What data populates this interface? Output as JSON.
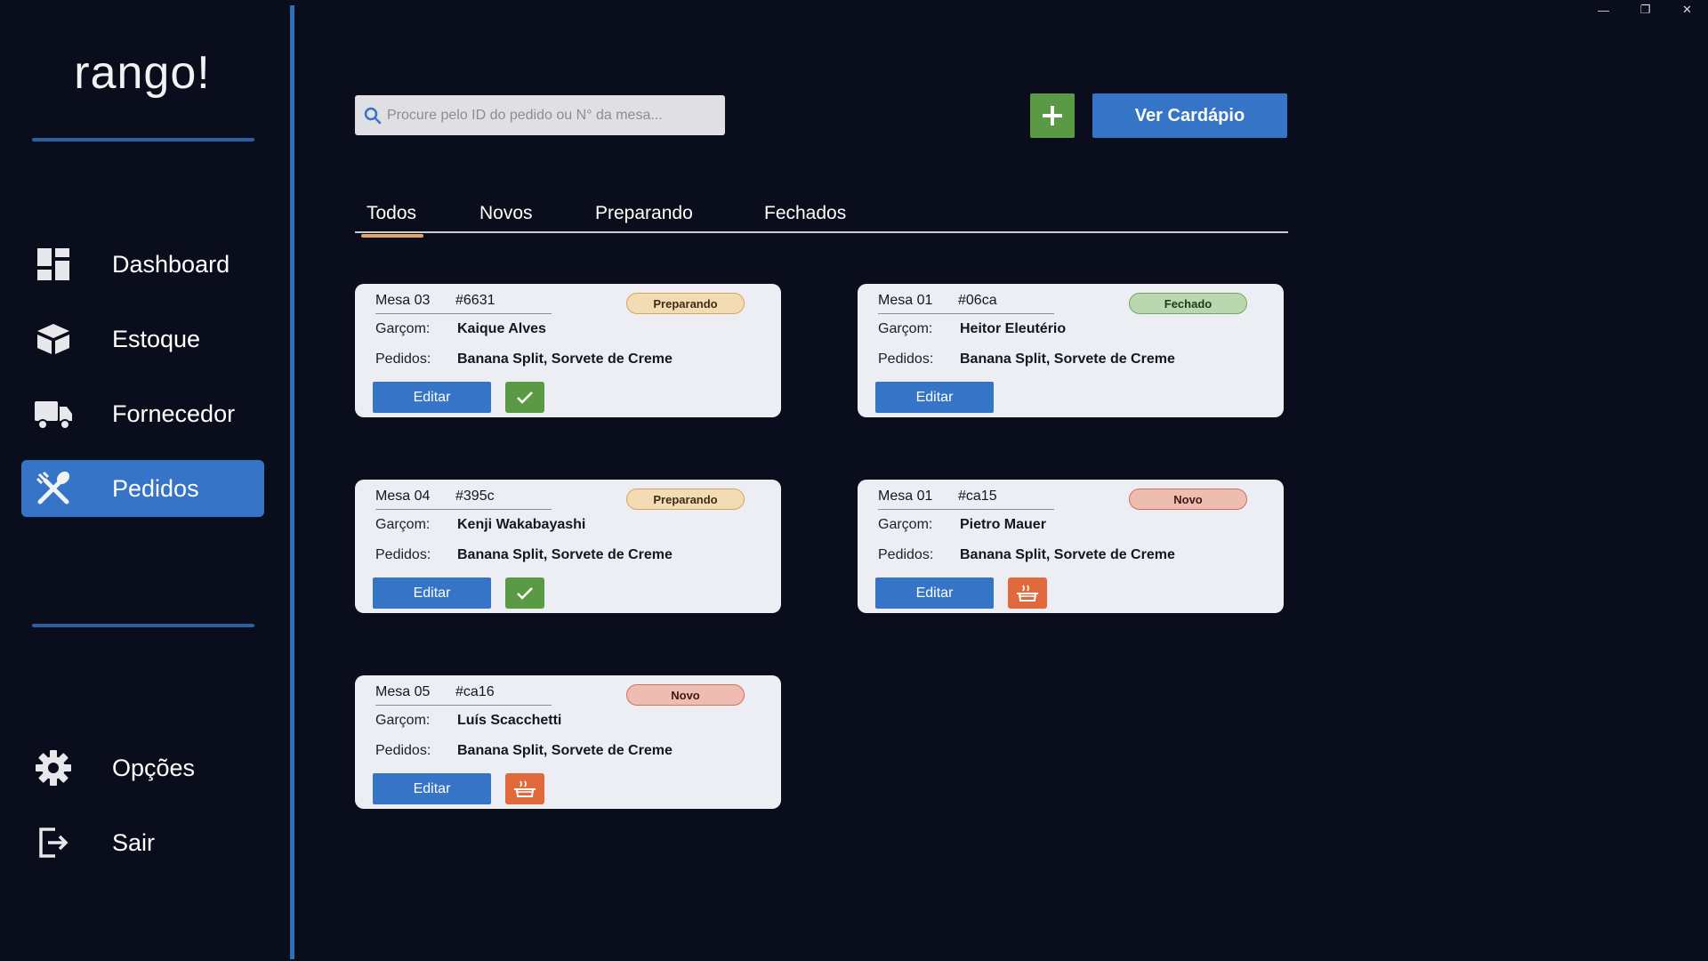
{
  "window": {
    "minimize": "—",
    "restore": "❐",
    "close": "✕"
  },
  "sidebar": {
    "logo": "rango!",
    "items": [
      {
        "label": "Dashboard",
        "icon": "dashboard-icon"
      },
      {
        "label": "Estoque",
        "icon": "box-icon"
      },
      {
        "label": "Fornecedor",
        "icon": "truck-icon"
      },
      {
        "label": "Pedidos",
        "icon": "cutlery-icon",
        "active": true
      }
    ],
    "bottom_items": [
      {
        "label": "Opções",
        "icon": "gear-icon"
      },
      {
        "label": "Sair",
        "icon": "logout-icon"
      }
    ]
  },
  "search": {
    "placeholder": "Procure pelo ID do pedido ou N° da mesa..."
  },
  "toolbar": {
    "add_label": "+",
    "menu_label": "Ver Cardápio"
  },
  "tabs": [
    {
      "label": "Todos",
      "active": true
    },
    {
      "label": "Novos"
    },
    {
      "label": "Preparando"
    },
    {
      "label": "Fechados"
    }
  ],
  "orders": [
    {
      "mesa": "Mesa 03",
      "id": "#6631",
      "status": "Preparando",
      "waiter_key": "Garçom:",
      "waiter": "Kaique Alves",
      "items_key": "Pedidos:",
      "items": "Banana Split, Sorvete de Creme",
      "edit": "Editar",
      "action": "check-icon"
    },
    {
      "mesa": "Mesa 01",
      "id": "#06ca",
      "status": "Fechado",
      "waiter_key": "Garçom:",
      "waiter": "Heitor Eleutério",
      "items_key": "Pedidos:",
      "items": "Banana Split, Sorvete de Creme",
      "edit": "Editar"
    },
    {
      "mesa": "Mesa 04",
      "id": "#395c",
      "status": "Preparando",
      "waiter_key": "Garçom:",
      "waiter": "Kenji Wakabayashi",
      "items_key": "Pedidos:",
      "items": "Banana Split, Sorvete de Creme",
      "edit": "Editar",
      "action": "check-icon"
    },
    {
      "mesa": "Mesa 01",
      "id": "#ca15",
      "status": "Novo",
      "waiter_key": "Garçom:",
      "waiter": "Pietro Mauer",
      "items_key": "Pedidos:",
      "items": "Banana Split, Sorvete de Creme",
      "edit": "Editar",
      "action": "cooking-pot-icon"
    },
    {
      "mesa": "Mesa 05",
      "id": "#ca16",
      "status": "Novo",
      "waiter_key": "Garçom:",
      "waiter": "Luís Scacchetti",
      "items_key": "Pedidos:",
      "items": "Banana Split, Sorvete de Creme",
      "edit": "Editar",
      "action": "cooking-pot-icon"
    }
  ],
  "colors": {
    "background": "#0a0e1c",
    "accent": "#3574c6",
    "success": "#5a9a45",
    "cook": "#e06a3c",
    "tab_underline": "#e3a565"
  }
}
